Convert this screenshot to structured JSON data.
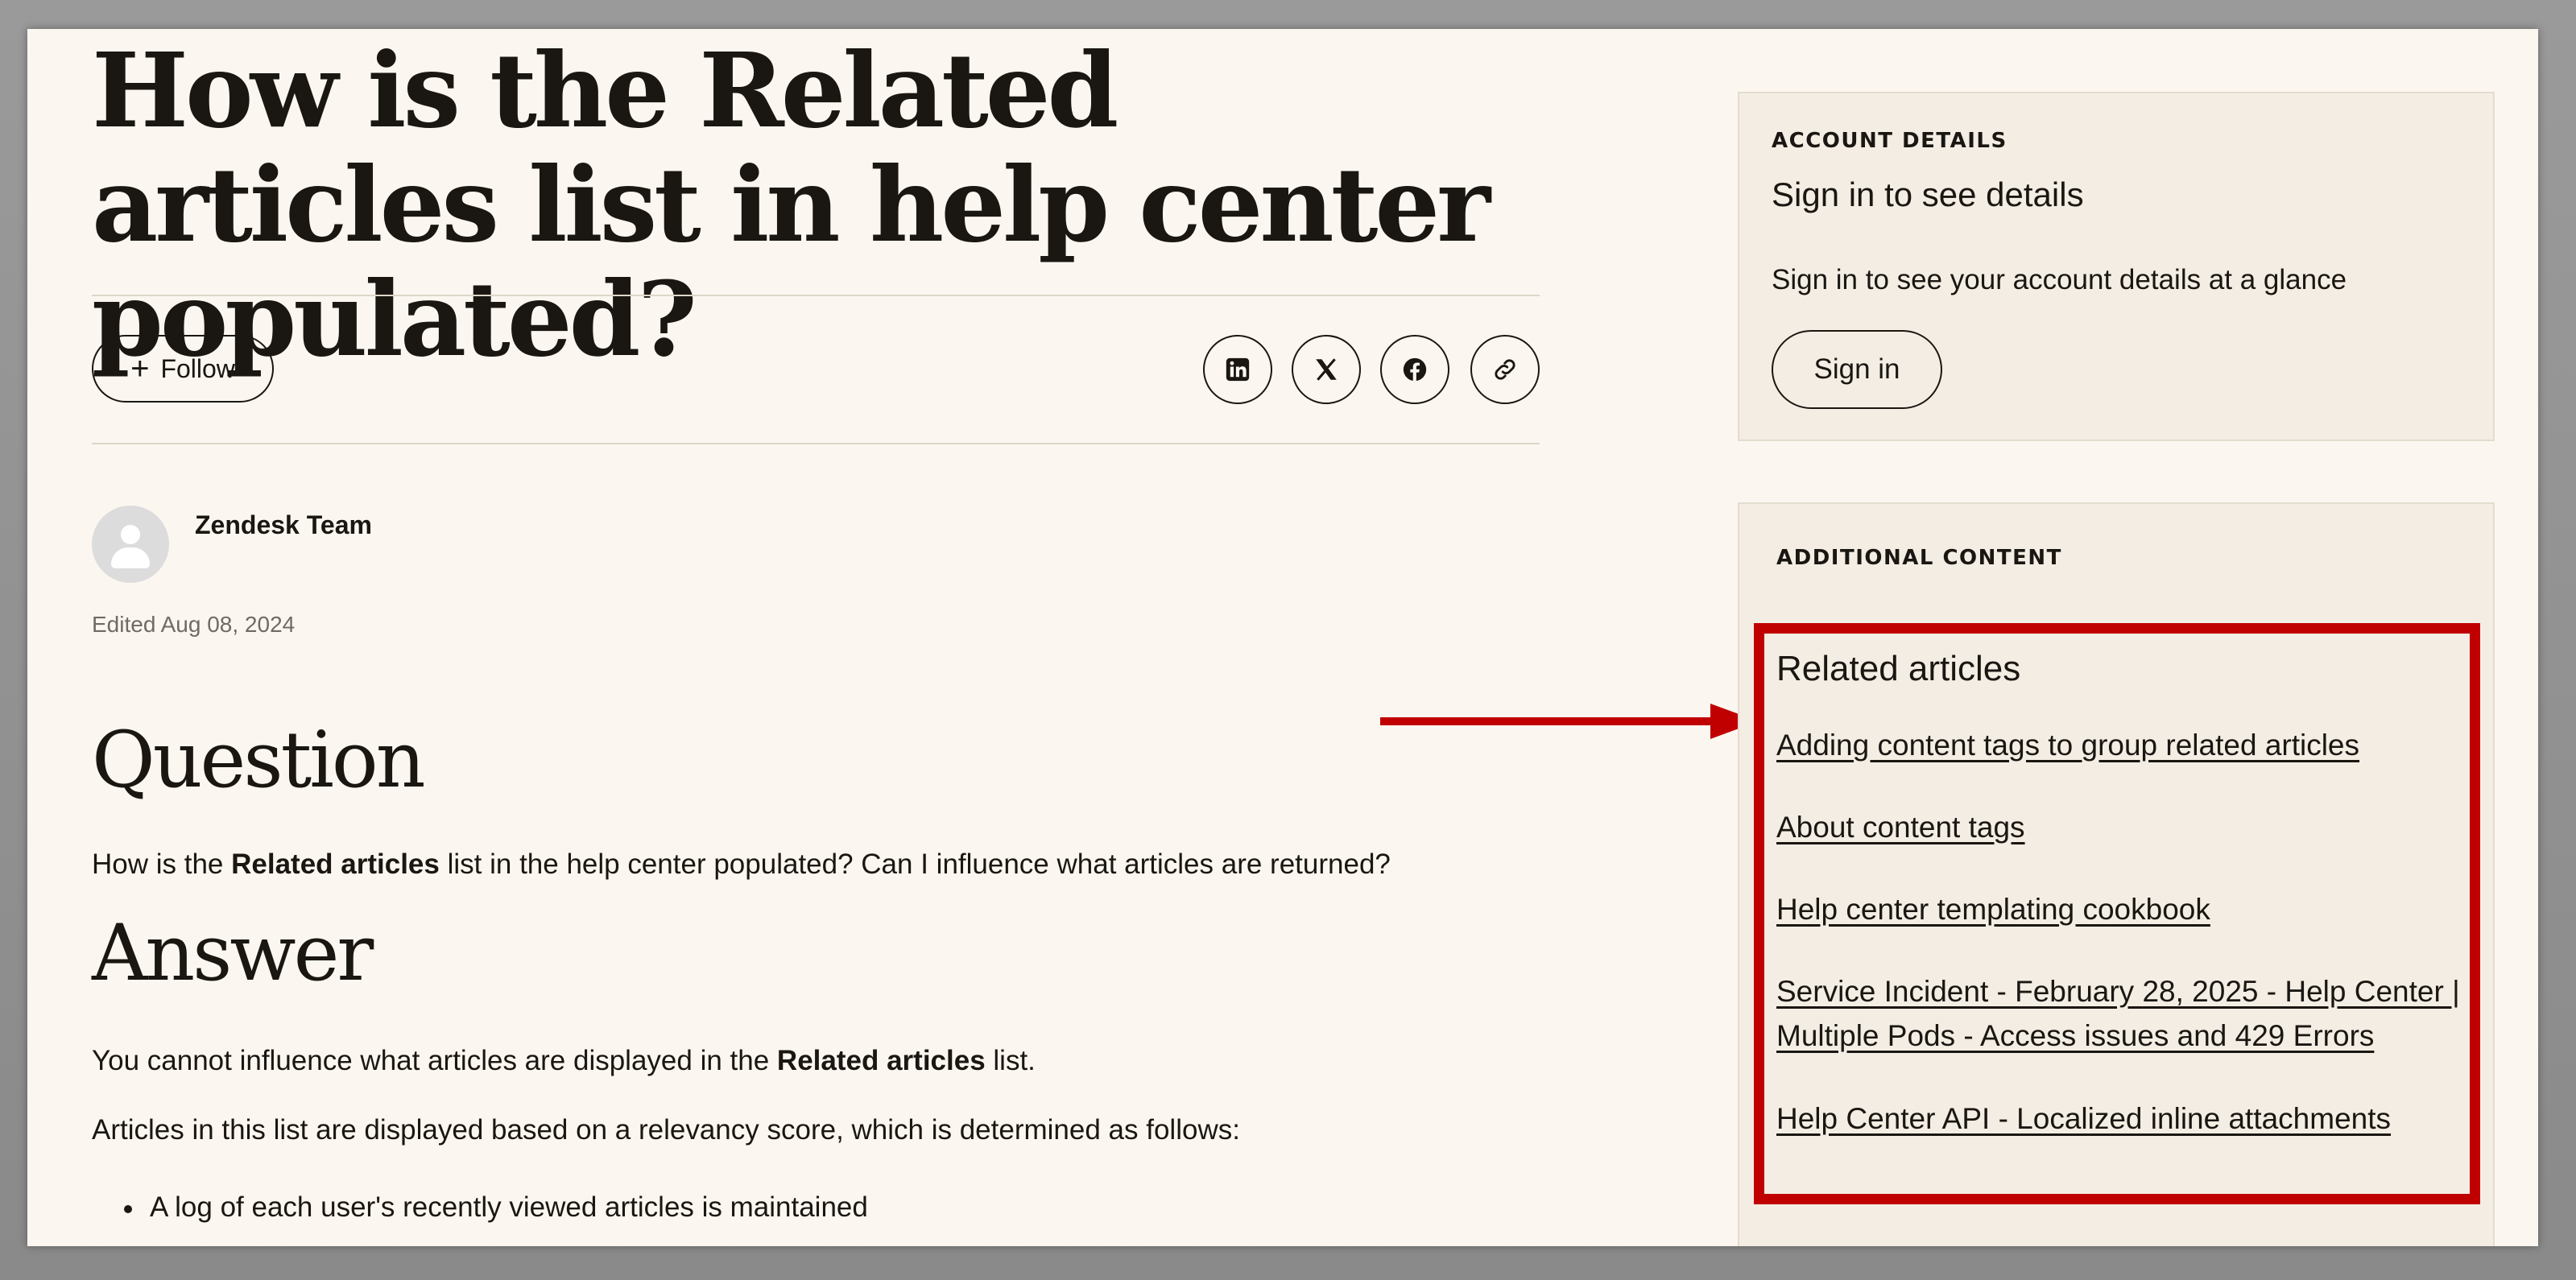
{
  "article": {
    "title": "How is the Related articles list in help center populated?",
    "follow_label": "Follow",
    "author": "Zendesk Team",
    "edited": "Edited Aug 08, 2024",
    "question_heading": "Question",
    "question_text_before": "How is the ",
    "question_text_bold": "Related articles",
    "question_text_after": " list in the help center populated? Can I influence what articles are returned?",
    "answer_heading": "Answer",
    "answer_p1_before": "You cannot influence what articles are displayed in the ",
    "answer_p1_bold": "Related articles",
    "answer_p1_after": " list.",
    "answer_p2": "Articles in this list are displayed based on a relevancy score, which is determined as follows:",
    "bullet_1": "A log of each user's recently viewed articles is maintained"
  },
  "share_icons": [
    "linkedin-icon",
    "x-icon",
    "facebook-icon",
    "link-icon"
  ],
  "account_card": {
    "eyebrow": "ACCOUNT DETAILS",
    "title": "Sign in to see details",
    "text": "Sign in to see your account details at a glance",
    "button": "Sign in"
  },
  "additional_card": {
    "eyebrow": "ADDITIONAL CONTENT",
    "related_title": "Related articles",
    "links": [
      "Adding content tags to group related articles",
      "About content tags",
      "Help center templating cookbook",
      "Service Incident - February 28, 2025 - Help Center | Multiple Pods - Access issues and 429 Errors",
      "Help Center API - Localized inline attachments"
    ]
  },
  "colors": {
    "highlight": "#c00000",
    "page_bg": "#fbf7f0",
    "card_bg": "#f3ede3",
    "text": "#1a1612"
  }
}
